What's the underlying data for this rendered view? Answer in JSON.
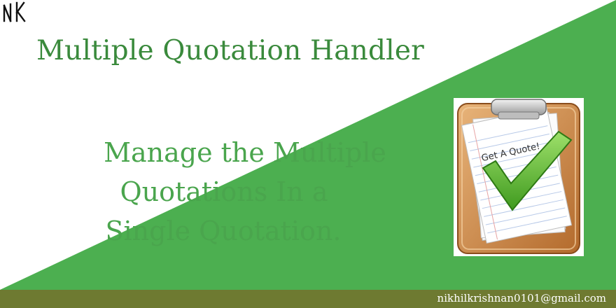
{
  "logo": {
    "text": "NK",
    "icon": "nk-monogram-icon"
  },
  "header": {
    "title": "Multiple Quotation Handler"
  },
  "tagline": {
    "line1": "Manage the Multiple",
    "line2": "Quotations In a",
    "line3": "Single Quotation."
  },
  "illustration": {
    "icon": "clipboard-checkmark-icon",
    "note_text": "Get A Quote!"
  },
  "footer": {
    "email": "nikhilkrishnan0101@gmail.com"
  },
  "colors": {
    "green": "#4caf50",
    "title_green": "#3a8a3c",
    "footer_olive": "#6e7a31",
    "background": "#ffffff"
  }
}
